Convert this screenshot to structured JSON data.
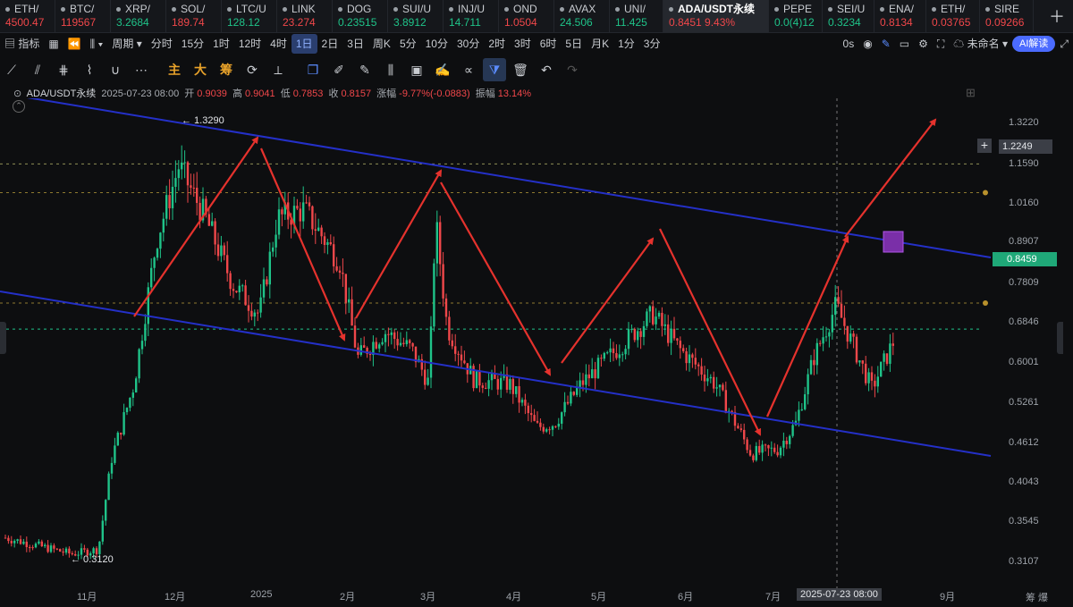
{
  "tickers": [
    {
      "name": "ETH/",
      "price": "4500.47",
      "dir": "dn"
    },
    {
      "name": "BTC/",
      "price": "119567",
      "dir": "dn"
    },
    {
      "name": "XRP/",
      "price": "3.2684",
      "dir": "up"
    },
    {
      "name": "SOL/",
      "price": "189.74",
      "dir": "dn"
    },
    {
      "name": "LTC/U",
      "price": "128.12",
      "dir": "up"
    },
    {
      "name": "LINK",
      "price": "23.274",
      "dir": "dn"
    },
    {
      "name": "DOG",
      "price": "0.23515",
      "dir": "up"
    },
    {
      "name": "SUI/U",
      "price": "3.8912",
      "dir": "up"
    },
    {
      "name": "INJ/U",
      "price": "14.711",
      "dir": "up"
    },
    {
      "name": "OND",
      "price": "1.0504",
      "dir": "dn"
    },
    {
      "name": "AVAX",
      "price": "24.506",
      "dir": "up"
    },
    {
      "name": "UNI/",
      "price": "11.425",
      "dir": "up"
    },
    {
      "name": "ADA/USDT永续",
      "price": "0.8451  9.43%",
      "dir": "dn",
      "active": true
    },
    {
      "name": "PEPE",
      "price": "0.0(4)12",
      "dir": "up"
    },
    {
      "name": "SEI/U",
      "price": "0.3234",
      "dir": "up"
    },
    {
      "name": "ENA/",
      "price": "0.8134",
      "dir": "dn"
    },
    {
      "name": "ETH/",
      "price": "0.03765",
      "dir": "dn"
    },
    {
      "name": "SIRE",
      "price": "0.09266",
      "dir": "dn"
    }
  ],
  "toolbar": {
    "indicator": "指标",
    "period": "周期",
    "intervals": [
      "分时",
      "15分",
      "1时",
      "12时",
      "4时",
      "1日",
      "2日",
      "3日",
      "周K",
      "5分",
      "10分",
      "30分",
      "2时",
      "3时",
      "6时",
      "5日",
      "月K",
      "1分",
      "3分"
    ],
    "selected": "1日",
    "seconds": "0s",
    "unnamed": "未命名",
    "ai": "AI解读"
  },
  "drawtools": {
    "zhu": "主",
    "da": "大",
    "chou": "筹"
  },
  "info": {
    "symbol": "ADA/USDT永续",
    "time": "2025-07-23 08:00",
    "open_label": "开",
    "open": "0.9039",
    "high_label": "高",
    "high": "0.9041",
    "low_label": "低",
    "low": "0.7853",
    "close_label": "收",
    "close": "0.8157",
    "chg_label": "涨幅",
    "chg": "-9.77%(-0.0883)",
    "amp_label": "振幅",
    "amp": "13.14%"
  },
  "colors": {
    "up": "#1fc389",
    "down": "#f0474a",
    "accent": "#2f6df6",
    "trend": "#2430c8",
    "arrow": "#e5322d"
  },
  "chart_data": {
    "type": "candlestick",
    "xlabels": [
      "11月",
      "12月",
      "2025",
      "2月",
      "3月",
      "4月",
      "5月",
      "6月",
      "7月",
      "9月"
    ],
    "ylabels": [
      "1.3220",
      "1.1590",
      "1.0160",
      "0.8907",
      "0.7809",
      "0.6846",
      "0.6001",
      "0.5261",
      "0.4612",
      "0.4043",
      "0.3545",
      "0.3107"
    ],
    "price_badges": [
      {
        "text": "1.2249",
        "kind": "crosshair"
      },
      {
        "text": "0.8459",
        "kind": "last"
      }
    ],
    "annotations": [
      {
        "text": "← 1.3290"
      },
      {
        "text": "← 0.3120"
      }
    ],
    "crosshair_time": "2025-07-23 08:00",
    "bottom_right": "筹 爆"
  }
}
